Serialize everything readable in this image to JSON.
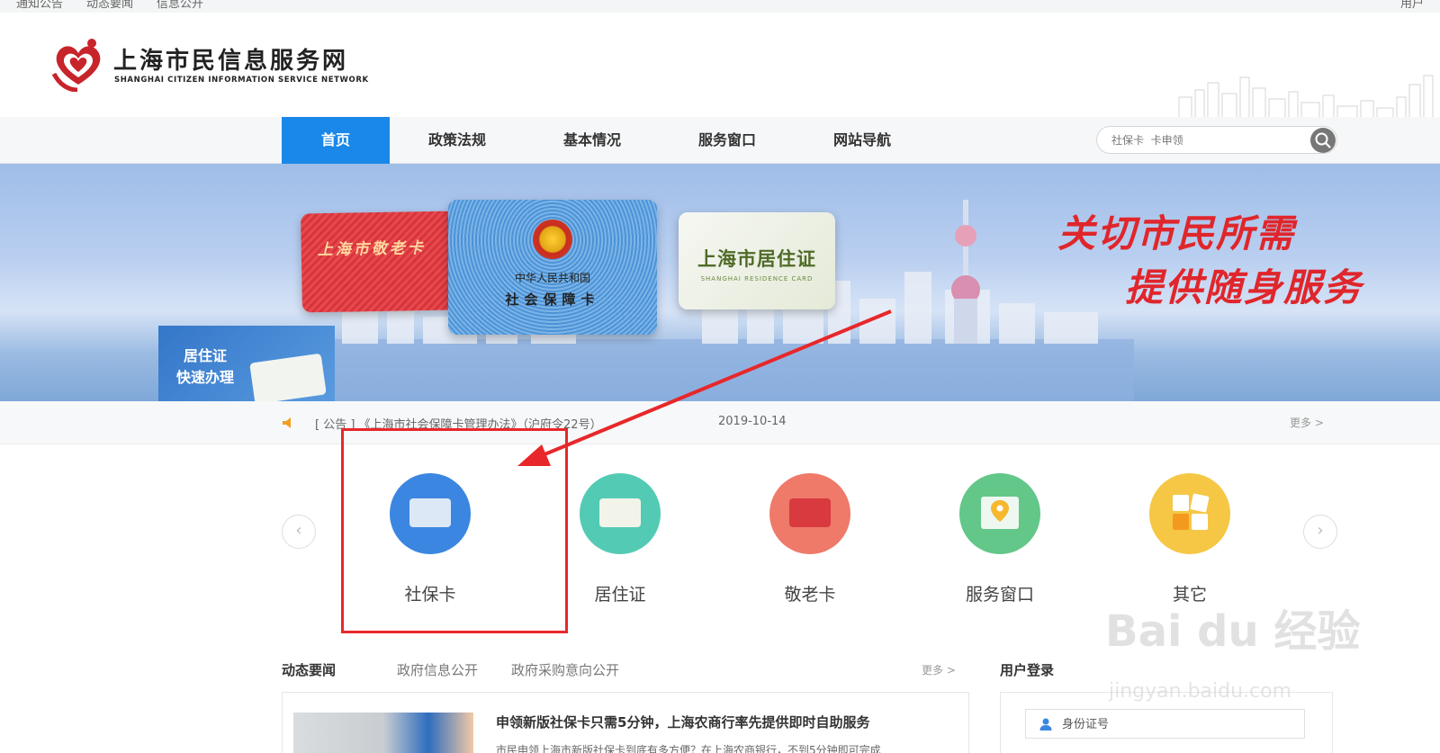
{
  "topbar": {
    "links": [
      "通知公告",
      "动态要闻",
      "信息公开"
    ],
    "right": "用户"
  },
  "header": {
    "title": "上海市民信息服务网",
    "subtitle": "SHANGHAI CITIZEN INFORMATION SERVICE NETWORK"
  },
  "nav": {
    "items": [
      "首页",
      "政策法规",
      "基本情况",
      "服务窗口",
      "网站导航"
    ],
    "active_index": 0
  },
  "search": {
    "placeholder": "社保卡  卡申领"
  },
  "banner": {
    "card_old": "上海市敬老卡",
    "card_social_line1": "中华人民共和国",
    "card_social_line2": "社会保障卡",
    "card_residence": "上海市居住证",
    "card_residence_en": "SHANGHAI RESIDENCE CARD",
    "quick_line1": "居住证",
    "quick_line2": "快速办理",
    "slogan_line1": "关切市民所需",
    "slogan_line2": "提供随身服务"
  },
  "notice": {
    "text": "[ 公告 ]  《上海市社会保障卡管理办法》（沪府令22号）",
    "date": "2019-10-14",
    "more": "更多  >"
  },
  "services": [
    {
      "label": "社保卡",
      "icon": "social-card-icon",
      "color": "#3b86e0"
    },
    {
      "label": "居住证",
      "icon": "residence-card-icon",
      "color": "#53cbb4"
    },
    {
      "label": "敬老卡",
      "icon": "senior-card-icon",
      "color": "#ef7a6a"
    },
    {
      "label": "服务窗口",
      "icon": "map-pin-icon",
      "color": "#62c788"
    },
    {
      "label": "其它",
      "icon": "blocks-icon",
      "color": "#f5c745"
    }
  ],
  "news": {
    "tabs": [
      "动态要闻",
      "政府信息公开",
      "政府采购意向公开"
    ],
    "more": "更多  >",
    "headline": "申领新版社保卡只需5分钟，上海农商行率先提供即时自助服务",
    "summary": "市民申领上海市新版社保卡到底有多方便？在上海农商银行，不到5分钟即可完成"
  },
  "login": {
    "title": "用户登录",
    "id_placeholder": "身份证号"
  },
  "watermark": {
    "brand": "Bai du 经验",
    "url": "jingyan.baidu.com"
  }
}
